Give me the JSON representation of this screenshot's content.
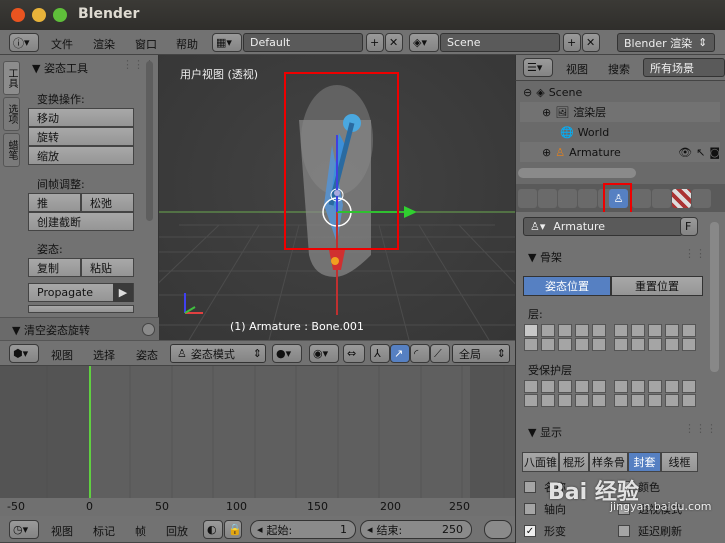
{
  "window": {
    "title": "Blender"
  },
  "info_header": {
    "menus": [
      "文件",
      "渲染",
      "窗口",
      "帮助"
    ],
    "screen": "Default",
    "scene": "Scene",
    "engine": "Blender 渲染"
  },
  "toolshelf": {
    "tabs": [
      "工具",
      "选项",
      "蜡笔"
    ],
    "panel_title": "▼ 姿态工具",
    "transform_label": "变换操作:",
    "transform_buttons": [
      "移动",
      "旋转",
      "缩放"
    ],
    "inbetween_label": "间帧调整:",
    "push": "推",
    "relax": "松弛",
    "breakdown": "创建截断",
    "pose_label": "姿态:",
    "copy": "复制",
    "paste": "粘贴",
    "propagate": "Propagate",
    "clear_panel": "▼ 清空姿态旋转"
  },
  "viewport": {
    "view_label": "用户视图 (透视)",
    "status": "(1) Armature : Bone.001"
  },
  "view3d_header": {
    "menus": [
      "视图",
      "选择",
      "姿态"
    ],
    "mode": "姿态模式",
    "global": "全局"
  },
  "outliner": {
    "menus": [
      "视图",
      "搜索"
    ],
    "filter": "所有场景",
    "items": [
      "Scene",
      "渲染层",
      "World",
      "Armature"
    ]
  },
  "properties": {
    "object_name": "Armature",
    "f_label": "F",
    "skeleton_title": "骨架",
    "pose_position": "姿态位置",
    "rest_position": "重置位置",
    "layers_label": "层:",
    "protected_label": "受保护层",
    "display_title": "显示",
    "display_types": [
      "八面锥",
      "棍形",
      "样条骨",
      "封套",
      "线框"
    ],
    "checkboxes": [
      "名称",
      "轴向",
      "形变",
      "颜色",
      "透视模式",
      "延迟刷新"
    ]
  },
  "timeline": {
    "ticks": [
      "-50",
      "0",
      "50",
      "100",
      "150",
      "200",
      "250"
    ],
    "menus": [
      "视图",
      "标记",
      "帧",
      "回放"
    ],
    "start_label": "起始:",
    "start_value": "1",
    "end_label": "结束:",
    "end_value": "250"
  },
  "watermark": {
    "text": "Bai 经验",
    "sub": "jingyan.baidu.com"
  }
}
